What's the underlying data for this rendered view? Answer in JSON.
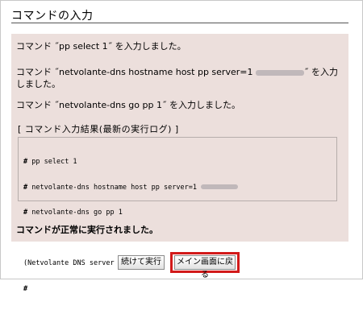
{
  "page": {
    "title": "コマンドの入力"
  },
  "messages": [
    {
      "prefix": "コマンド ˝",
      "command": "pp select 1",
      "suffix": "˝ を入力しました。"
    },
    {
      "prefix": "コマンド ˝",
      "command": "netvolante-dns hostname host pp server=1",
      "suffix": "˝ を入力",
      "continuation": "しました。"
    },
    {
      "prefix": "コマンド ˝",
      "command": "netvolante-dns go pp 1",
      "suffix": "˝ を入力しました。"
    }
  ],
  "log": {
    "title": "[ コマンド入力結果(最新の実行ログ) ]",
    "prompt": "#",
    "lines": [
      "pp select 1",
      "netvolante-dns hostname host pp server=1",
      "netvolante-dns go pp 1",
      "(Netvolante DNS server 1)"
    ]
  },
  "status": "コマンドが正常に実行されました。",
  "buttons": {
    "continue": "続けて実行",
    "main_menu": "メイン画面に戻る"
  },
  "colors": {
    "panel_background": "#ecdfdc",
    "highlight": "#d21a1a"
  }
}
